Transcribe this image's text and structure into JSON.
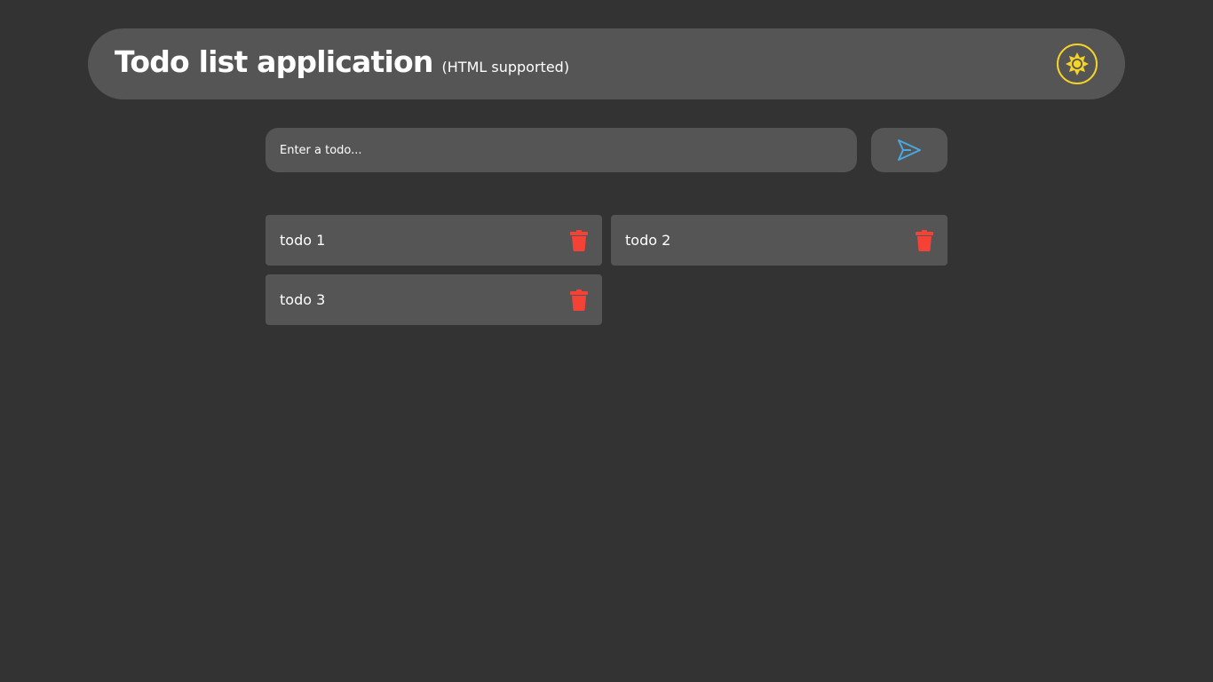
{
  "header": {
    "title": "Todo list application",
    "subtitle": "(HTML supported)",
    "theme_icon": "sun-icon",
    "theme_color": "#f5d327"
  },
  "composer": {
    "placeholder": "Enter a todo...",
    "value": "",
    "send_icon": "send-icon",
    "send_color": "#4aa8e0"
  },
  "todos": [
    {
      "text": "todo 1",
      "delete_icon": "trash-icon"
    },
    {
      "text": "todo 2",
      "delete_icon": "trash-icon"
    },
    {
      "text": "todo 3",
      "delete_icon": "trash-icon"
    }
  ],
  "colors": {
    "background": "#333333",
    "surface": "#555555",
    "delete": "#f44336"
  }
}
